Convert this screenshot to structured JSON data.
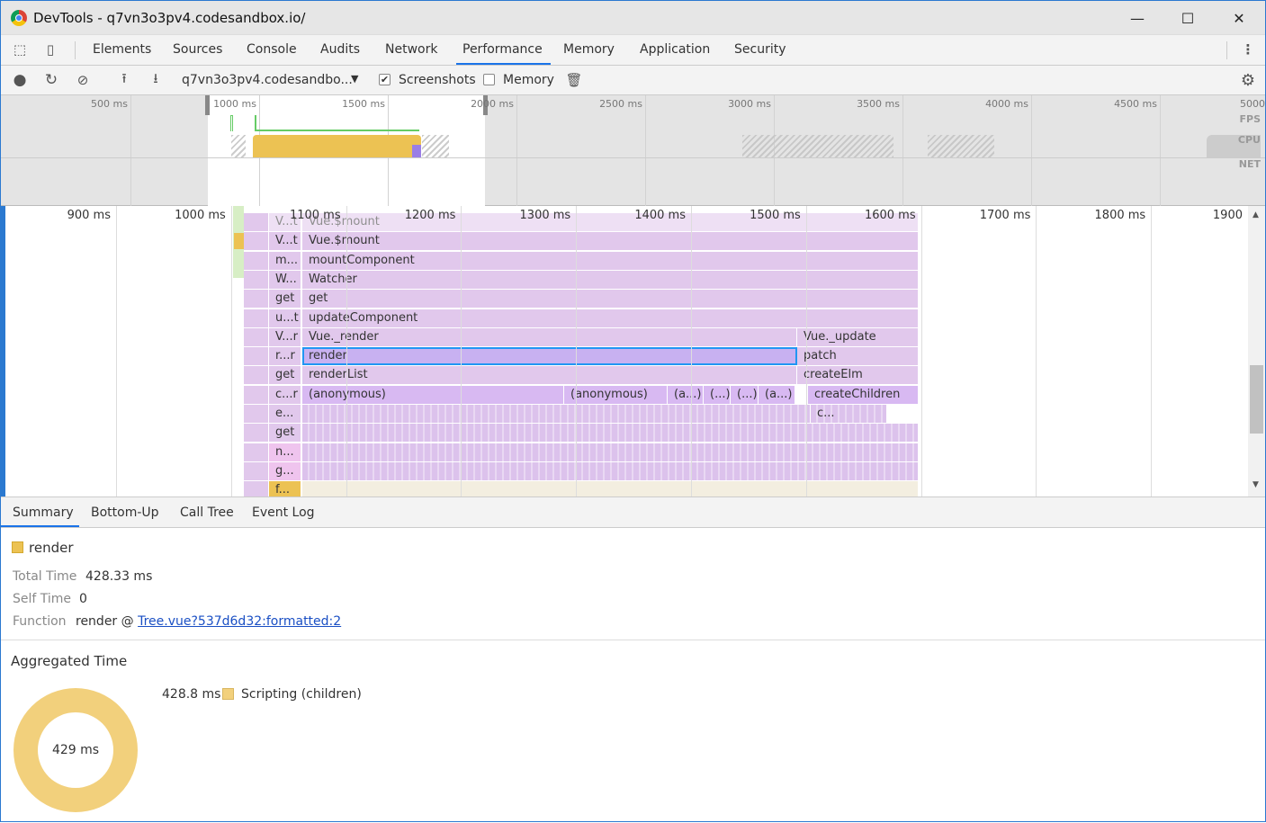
{
  "window": {
    "title": "DevTools - q7vn3o3pv4.codesandbox.io/",
    "minimize": "—",
    "maximize": "☐",
    "close": "✕"
  },
  "tabs": [
    {
      "label": "Elements"
    },
    {
      "label": "Sources"
    },
    {
      "label": "Console"
    },
    {
      "label": "Audits"
    },
    {
      "label": "Network"
    },
    {
      "label": "Performance",
      "active": true
    },
    {
      "label": "Memory"
    },
    {
      "label": "Application"
    },
    {
      "label": "Security"
    }
  ],
  "toolbar": {
    "profile_select": "q7vn3o3pv4.codesandbo...",
    "screenshots_label": "Screenshots",
    "screenshots_checked": true,
    "memory_label": "Memory",
    "memory_checked": false
  },
  "overview": {
    "ticks": [
      "500 ms",
      "1000 ms",
      "1500 ms",
      "2000 ms",
      "2500 ms",
      "3000 ms",
      "3500 ms",
      "4000 ms",
      "4500 ms",
      "5000"
    ],
    "tracks": [
      "FPS",
      "CPU",
      "NET"
    ],
    "colors": {
      "scripting": "#ecc253",
      "rendering": "#9a7ee6",
      "idle": "#d8d8d8"
    }
  },
  "flame": {
    "ticks": [
      "900 ms",
      "1000 ms",
      "1100 ms",
      "1200 ms",
      "1300 ms",
      "1400 ms",
      "1500 ms",
      "1600 ms",
      "1700 ms",
      "1800 ms",
      "1900"
    ],
    "rows": [
      {
        "short": "V...t",
        "main": [
          {
            "label": "Vue.$mount"
          }
        ]
      },
      {
        "short": "V...t",
        "main": [
          {
            "label": "Vue.$mount"
          }
        ]
      },
      {
        "short": "m...",
        "main": [
          {
            "label": "mountComponent"
          }
        ]
      },
      {
        "short": "W...",
        "main": [
          {
            "label": "Watcher"
          }
        ]
      },
      {
        "short": "get",
        "main": [
          {
            "label": "get"
          }
        ]
      },
      {
        "short": "u...t",
        "main": [
          {
            "label": "updateComponent"
          }
        ]
      },
      {
        "short": "V...r",
        "main": [
          {
            "label": "Vue._render"
          },
          {
            "label": "Vue._update"
          }
        ]
      },
      {
        "short": "r...r",
        "main": [
          {
            "label": "render",
            "selected": true
          },
          {
            "label": "patch"
          }
        ]
      },
      {
        "short": "get",
        "main": [
          {
            "label": "renderList"
          },
          {
            "label": "createElm"
          }
        ]
      },
      {
        "short": "c...r",
        "main": [
          {
            "label": "(anonymous)"
          },
          {
            "label": "(anonymous)"
          },
          {
            "label": "(a...)"
          },
          {
            "label": "(...)"
          },
          {
            "label": "(...)"
          },
          {
            "label": "(a...)"
          },
          {
            "label": "createChildren"
          }
        ]
      },
      {
        "short": "e...",
        "main": [
          {
            "label": ""
          },
          {
            "label": "c..."
          }
        ]
      },
      {
        "short": "get",
        "main": [
          {
            "label": ""
          }
        ]
      },
      {
        "short": "n...",
        "main": [
          {
            "label": ""
          }
        ]
      },
      {
        "short": "g...",
        "main": [
          {
            "label": ""
          }
        ]
      },
      {
        "short": "f...",
        "main": [
          {
            "label": ""
          }
        ]
      }
    ]
  },
  "details": {
    "tabs": [
      "Summary",
      "Bottom-Up",
      "Call Tree",
      "Event Log"
    ],
    "summary": {
      "name": "render",
      "color": "#ecc253",
      "total_time_label": "Total Time",
      "total_time": "428.33 ms",
      "self_time_label": "Self Time",
      "self_time": "0",
      "function_label": "Function",
      "function_name": "render @ ",
      "function_link": "Tree.vue?537d6d32:formatted:2"
    },
    "aggregated": {
      "title": "Aggregated Time",
      "center": "429 ms",
      "legend_value": "428.8 ms",
      "legend_label": "Scripting (children)",
      "color": "#f2d07c"
    }
  }
}
